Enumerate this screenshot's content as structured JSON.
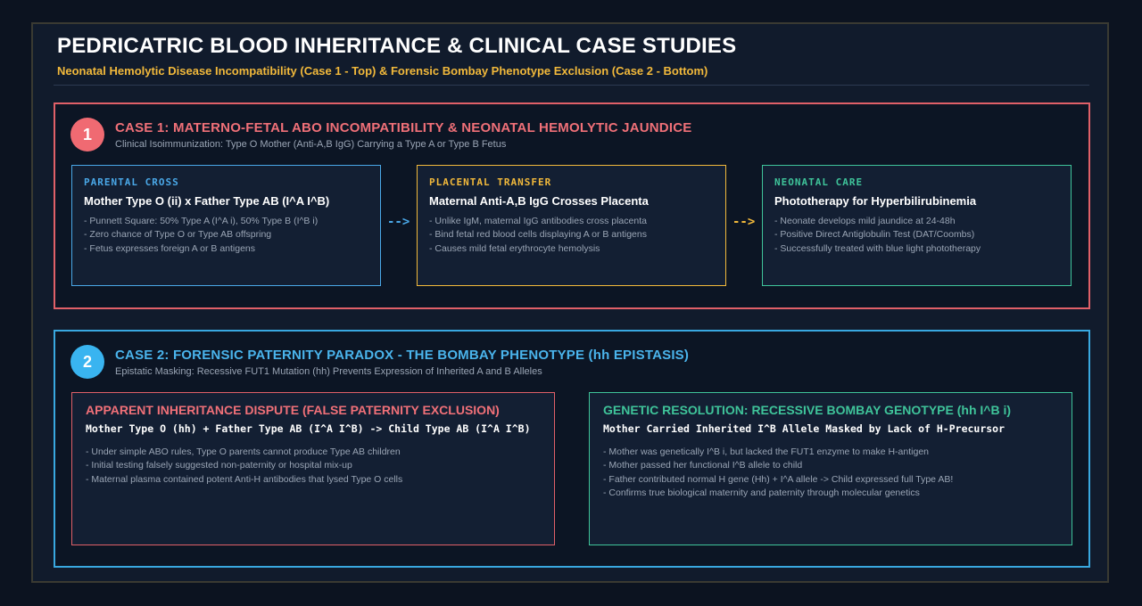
{
  "header": {
    "title": "PEDRICATRIC BLOOD INHERITANCE & CLINICAL CASE STUDIES",
    "subtitle": "Neonatal Hemolytic Disease Incompatibility (Case 1 - Top) & Forensic Bombay Phenotype Exclusion (Case 2 - Bottom)"
  },
  "colors": {
    "case1_accent": "#e06068",
    "case2_accent": "#39a8e0",
    "blue": "#4aa8e8",
    "amber": "#f2b93b",
    "green": "#3fc49a",
    "red": "#e06068"
  },
  "case1": {
    "number": "1",
    "title": "CASE 1: MATERNO-FETAL ABO INCOMPATIBILITY & NEONATAL HEMOLYTIC JAUNDICE",
    "subtitle": "Clinical Isoimmunization: Type O Mother (Anti-A,B IgG) Carrying a Type A or Type B Fetus",
    "arrow": "-->",
    "steps": [
      {
        "label": "PARENTAL CROSS",
        "heading": "Mother Type O (ii) x Father Type AB (I^A I^B)",
        "bullets": [
          "- Punnett Square: 50% Type A (I^A i), 50% Type B (I^B i)",
          "- Zero chance of Type O or Type AB offspring",
          "- Fetus expresses foreign A or B antigens"
        ]
      },
      {
        "label": "PLACENTAL TRANSFER",
        "heading": "Maternal Anti-A,B IgG Crosses Placenta",
        "bullets": [
          "- Unlike IgM, maternal IgG antibodies cross placenta",
          "- Bind fetal red blood cells displaying A or B antigens",
          "- Causes mild fetal erythrocyte hemolysis"
        ]
      },
      {
        "label": "NEONATAL CARE",
        "heading": "Phototherapy for Hyperbilirubinemia",
        "bullets": [
          "- Neonate develops mild jaundice at 24-48h",
          "- Positive Direct Antiglobulin Test (DAT/Coombs)",
          "- Successfully treated with blue light phototherapy"
        ]
      }
    ]
  },
  "case2": {
    "number": "2",
    "title": "CASE 2: FORENSIC PATERNITY PARADOX - THE BOMBAY PHENOTYPE (hh EPISTASIS)",
    "subtitle": "Epistatic Masking: Recessive FUT1 Mutation (hh) Prevents Expression of Inherited A and B Alleles",
    "panels": [
      {
        "title": "APPARENT INHERITANCE DISPUTE (FALSE PATERNITY EXCLUSION)",
        "heading": "Mother Type O (hh) + Father Type AB (I^A I^B) -> Child Type AB (I^A I^B)",
        "bullets": [
          "- Under simple ABO rules, Type O parents cannot produce Type AB children",
          "- Initial testing falsely suggested non-paternity or hospital mix-up",
          "- Maternal plasma contained potent Anti-H antibodies that lysed Type O cells"
        ]
      },
      {
        "title": "GENETIC RESOLUTION: RECESSIVE BOMBAY GENOTYPE (hh I^B i)",
        "heading": "Mother Carried Inherited I^B Allele Masked by Lack of H-Precursor",
        "bullets": [
          "- Mother was genetically I^B i, but lacked the FUT1 enzyme to make H-antigen",
          "- Mother passed her functional I^B allele to child",
          "- Father contributed normal H gene (Hh) + I^A allele -> Child expressed full Type AB!",
          "- Confirms true biological maternity and paternity through molecular genetics"
        ]
      }
    ]
  }
}
